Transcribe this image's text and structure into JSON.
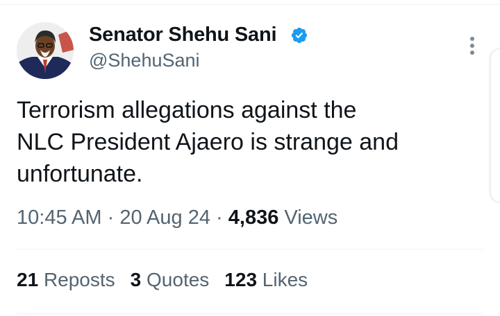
{
  "author": {
    "name": "Senator Shehu Sani",
    "handle": "@ShehuSani",
    "verified": true
  },
  "tweet": {
    "lines": [
      "Terrorism allegations against the",
      "NLC President Ajaero is strange and",
      "unfortunate."
    ],
    "time": "10:45 AM",
    "separator": "·",
    "date": "20 Aug 24",
    "views_count": "4,836",
    "views_label": "Views"
  },
  "stats": {
    "reposts_count": "21",
    "reposts_label": "Reposts",
    "quotes_count": "3",
    "quotes_label": "Quotes",
    "likes_count": "123",
    "likes_label": "Likes"
  },
  "colors": {
    "verified_blue": "#1d9bf0",
    "secondary_text": "#536471",
    "primary_text": "#0f1419"
  },
  "icons": {
    "verified": "verified-badge-icon",
    "more": "more-vertical-icon"
  }
}
